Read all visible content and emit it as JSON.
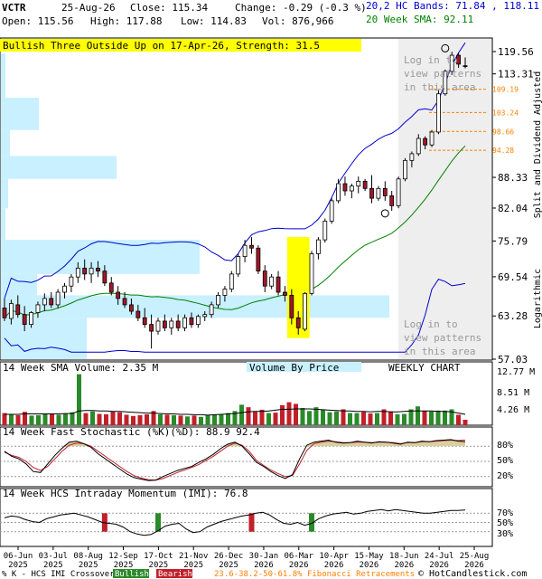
{
  "header": {
    "symbol": "VCTR",
    "date": "25-Aug-26",
    "close_label": "Close: 115.34",
    "change_label": "Change: -0.29 (-0.3 %)",
    "open_label": "Open: 115.56",
    "high_label": "High: 117.88",
    "low_label": "Low: 114.83",
    "vol_label": "Vol: 876,966",
    "hc_bands_label": "20,2 HC Bands: 71.84 , 118.11",
    "sma_label": "20 Week SMA: 92.11",
    "pattern_banner": "Bullish Three Outside Up on 17-Apr-26, Strength: 31.5"
  },
  "overlay_text": {
    "login_top": [
      "Log in to",
      "view patterns",
      "in this area"
    ],
    "login_bottom": [
      "Log in to",
      "view patterns",
      "in this area"
    ],
    "side_label": "Split and Dividend Adjusted",
    "log_label": "Logarithmic",
    "weekly_chart": "WEEKLY CHART",
    "volume_by_price": "Volume By Price"
  },
  "colors": {
    "bull": "#2a8a2a",
    "bear": "#c0202a",
    "band": "#0000cc",
    "sma": "#008000",
    "vbp": "#c8f0ff",
    "highlight": "#ffff00",
    "fib": "#ff7f00",
    "shade": "#eeeeee"
  },
  "chart_data": [
    {
      "type": "candlestick",
      "scale": "log",
      "ylim": [
        57.03,
        119.56
      ],
      "price_ticks": [
        119.56,
        113.31,
        88.33,
        82.04,
        75.79,
        69.54,
        63.28,
        57.03
      ],
      "fib_levels": [
        "109.19",
        "103.24",
        "98.66",
        "94.28"
      ],
      "candles": [
        {
          "o": 64.5,
          "h": 66.0,
          "l": 62.5,
          "c": 63.0
        },
        {
          "o": 62.9,
          "h": 65.8,
          "l": 62.0,
          "c": 65.2
        },
        {
          "o": 65.0,
          "h": 66.5,
          "l": 63.0,
          "c": 63.5
        },
        {
          "o": 63.5,
          "h": 64.8,
          "l": 61.0,
          "c": 62.0
        },
        {
          "o": 62.0,
          "h": 64.0,
          "l": 61.5,
          "c": 63.8
        },
        {
          "o": 63.8,
          "h": 65.5,
          "l": 63.0,
          "c": 65.0
        },
        {
          "o": 65.0,
          "h": 66.8,
          "l": 64.0,
          "c": 66.0
        },
        {
          "o": 66.0,
          "h": 67.0,
          "l": 64.5,
          "c": 65.0
        },
        {
          "o": 65.0,
          "h": 67.5,
          "l": 64.5,
          "c": 67.0
        },
        {
          "o": 67.0,
          "h": 68.5,
          "l": 66.0,
          "c": 68.0
        },
        {
          "o": 68.0,
          "h": 70.0,
          "l": 67.0,
          "c": 69.5
        },
        {
          "o": 69.5,
          "h": 72.0,
          "l": 68.5,
          "c": 71.0
        },
        {
          "o": 71.0,
          "h": 72.5,
          "l": 69.0,
          "c": 70.0
        },
        {
          "o": 70.0,
          "h": 72.0,
          "l": 68.5,
          "c": 71.0
        },
        {
          "o": 71.0,
          "h": 72.2,
          "l": 69.5,
          "c": 70.5
        },
        {
          "o": 70.5,
          "h": 71.5,
          "l": 68.0,
          "c": 68.5
        },
        {
          "o": 68.5,
          "h": 69.5,
          "l": 66.5,
          "c": 67.0
        },
        {
          "o": 67.0,
          "h": 68.0,
          "l": 65.0,
          "c": 66.0
        },
        {
          "o": 66.0,
          "h": 67.0,
          "l": 64.5,
          "c": 65.0
        },
        {
          "o": 65.0,
          "h": 66.0,
          "l": 63.5,
          "c": 64.0
        },
        {
          "o": 64.0,
          "h": 65.0,
          "l": 62.5,
          "c": 63.0
        },
        {
          "o": 63.0,
          "h": 64.5,
          "l": 61.5,
          "c": 62.0
        },
        {
          "o": 62.0,
          "h": 63.5,
          "l": 58.5,
          "c": 61.0
        },
        {
          "o": 61.0,
          "h": 63.0,
          "l": 60.5,
          "c": 62.5
        },
        {
          "o": 62.5,
          "h": 63.5,
          "l": 61.0,
          "c": 61.5
        },
        {
          "o": 61.5,
          "h": 63.0,
          "l": 60.5,
          "c": 62.5
        },
        {
          "o": 62.5,
          "h": 63.5,
          "l": 61.0,
          "c": 61.5
        },
        {
          "o": 61.5,
          "h": 63.5,
          "l": 61.0,
          "c": 63.0
        },
        {
          "o": 63.0,
          "h": 63.8,
          "l": 61.5,
          "c": 62.0
        },
        {
          "o": 62.0,
          "h": 63.5,
          "l": 61.5,
          "c": 63.2
        },
        {
          "o": 63.2,
          "h": 64.0,
          "l": 62.5,
          "c": 63.5
        },
        {
          "o": 63.5,
          "h": 65.5,
          "l": 63.0,
          "c": 65.0
        },
        {
          "o": 65.0,
          "h": 67.0,
          "l": 64.5,
          "c": 66.5
        },
        {
          "o": 66.5,
          "h": 68.0,
          "l": 65.5,
          "c": 67.5
        },
        {
          "o": 67.5,
          "h": 70.5,
          "l": 67.0,
          "c": 70.0
        },
        {
          "o": 70.0,
          "h": 73.5,
          "l": 69.5,
          "c": 73.0
        },
        {
          "o": 73.0,
          "h": 76.0,
          "l": 72.0,
          "c": 75.0
        },
        {
          "o": 75.0,
          "h": 76.5,
          "l": 73.5,
          "c": 74.5
        },
        {
          "o": 74.5,
          "h": 75.0,
          "l": 70.0,
          "c": 70.5
        },
        {
          "o": 70.5,
          "h": 71.5,
          "l": 67.0,
          "c": 68.0
        },
        {
          "o": 68.0,
          "h": 70.0,
          "l": 67.5,
          "c": 69.5
        },
        {
          "o": 69.5,
          "h": 70.5,
          "l": 66.5,
          "c": 67.0
        },
        {
          "o": 67.0,
          "h": 68.0,
          "l": 65.5,
          "c": 66.5
        },
        {
          "o": 66.5,
          "h": 67.5,
          "l": 62.0,
          "c": 63.0
        },
        {
          "o": 63.0,
          "h": 64.0,
          "l": 60.5,
          "c": 61.5
        },
        {
          "o": 61.3,
          "h": 67.0,
          "l": 61.0,
          "c": 66.8
        },
        {
          "o": 66.8,
          "h": 74.0,
          "l": 66.5,
          "c": 73.5
        },
        {
          "o": 73.5,
          "h": 76.5,
          "l": 72.5,
          "c": 76.0
        },
        {
          "o": 76.0,
          "h": 80.0,
          "l": 75.5,
          "c": 79.5
        },
        {
          "o": 79.5,
          "h": 84.0,
          "l": 79.0,
          "c": 83.5
        },
        {
          "o": 83.5,
          "h": 88.0,
          "l": 83.0,
          "c": 87.0
        },
        {
          "o": 87.0,
          "h": 88.5,
          "l": 84.5,
          "c": 85.5
        },
        {
          "o": 85.5,
          "h": 87.0,
          "l": 84.0,
          "c": 86.5
        },
        {
          "o": 86.5,
          "h": 88.5,
          "l": 85.0,
          "c": 87.5
        },
        {
          "o": 87.5,
          "h": 88.0,
          "l": 85.5,
          "c": 86.0
        },
        {
          "o": 86.0,
          "h": 88.8,
          "l": 83.0,
          "c": 84.0
        },
        {
          "o": 84.0,
          "h": 86.5,
          "l": 83.5,
          "c": 86.0
        },
        {
          "o": 86.0,
          "h": 87.5,
          "l": 83.5,
          "c": 84.5
        },
        {
          "o": 84.5,
          "h": 85.5,
          "l": 81.5,
          "c": 82.5
        },
        {
          "o": 82.5,
          "h": 88.5,
          "l": 82.0,
          "c": 88.0
        },
        {
          "o": 88.0,
          "h": 92.5,
          "l": 87.5,
          "c": 92.0
        },
        {
          "o": 92.0,
          "h": 94.0,
          "l": 90.5,
          "c": 93.5
        },
        {
          "o": 93.5,
          "h": 98.0,
          "l": 93.0,
          "c": 97.0
        },
        {
          "o": 97.0,
          "h": 97.5,
          "l": 94.5,
          "c": 95.5
        },
        {
          "o": 95.5,
          "h": 99.0,
          "l": 95.0,
          "c": 98.5
        },
        {
          "o": 98.5,
          "h": 109.0,
          "l": 98.0,
          "c": 108.0
        },
        {
          "o": 108.0,
          "h": 114.5,
          "l": 107.5,
          "c": 114.0
        },
        {
          "o": 114.0,
          "h": 119.5,
          "l": 113.0,
          "c": 118.5
        },
        {
          "o": 118.5,
          "h": 119.2,
          "l": 115.0,
          "c": 116.0
        },
        {
          "o": 115.56,
          "h": 117.88,
          "l": 114.83,
          "c": 115.34
        }
      ],
      "volume": {
        "label": "14 Week SMA Volume: 2.35 M",
        "ticks": [
          "12.77 M",
          "8.51 M",
          "4.26 M"
        ],
        "ymax": 12.77,
        "bars": [
          2.9,
          2.7,
          2.4,
          3.2,
          2.3,
          2.4,
          2.6,
          2.8,
          2.5,
          2.7,
          3.1,
          12.2,
          2.9,
          3.3,
          2.7,
          2.6,
          3.3,
          3.1,
          2.5,
          2.2,
          2.4,
          2.6,
          3.4,
          2.6,
          2.5,
          2.4,
          2.3,
          2.1,
          2.3,
          2.0,
          2.4,
          2.6,
          2.5,
          2.9,
          3.4,
          4.9,
          4.3,
          3.2,
          3.7,
          2.9,
          3.0,
          4.8,
          5.5,
          5.1,
          4.1,
          3.4,
          4.3,
          3.7,
          3.1,
          3.3,
          3.8,
          2.9,
          2.9,
          3.2,
          2.8,
          2.9,
          3.8,
          3.3,
          2.6,
          2.7,
          3.8,
          4.5,
          3.4,
          3.3,
          3.5,
          3.5,
          3.8,
          2.5,
          1.3
        ],
        "sma": [
          2.6,
          2.6,
          2.6,
          2.7,
          2.7,
          2.7,
          2.7,
          2.7,
          2.7,
          2.8,
          2.8,
          3.4,
          3.5,
          3.5,
          3.4,
          3.4,
          3.3,
          3.3,
          3.2,
          3.1,
          3.0,
          2.9,
          2.9,
          2.8,
          2.7,
          2.7,
          2.6,
          2.6,
          2.5,
          2.5,
          2.4,
          2.5,
          2.6,
          2.7,
          2.8,
          3.0,
          3.2,
          3.3,
          3.3,
          3.4,
          3.6,
          3.8,
          3.8,
          3.9,
          3.9,
          3.9,
          3.8,
          3.7,
          3.6,
          3.5,
          3.4,
          3.4,
          3.3,
          3.3,
          3.2,
          3.3,
          3.3,
          3.2,
          3.2,
          3.3,
          3.4,
          3.4,
          3.4,
          3.4,
          3.3,
          3.3,
          3.2,
          2.9,
          2.6
        ]
      },
      "stochastic": {
        "label": "14 Week Fast Stochastic (%K)(%D): 88.9 92.4",
        "ticks": [
          "80%",
          "50%",
          "20%"
        ],
        "k": [
          70,
          60,
          55,
          45,
          30,
          28,
          45,
          62,
          76,
          88,
          90,
          85,
          78,
          65,
          55,
          45,
          35,
          25,
          18,
          15,
          12,
          13,
          20,
          26,
          32,
          36,
          40,
          48,
          55,
          64,
          75,
          84,
          88,
          80,
          65,
          48,
          40,
          30,
          22,
          16,
          24,
          55,
          82,
          88,
          90,
          92,
          88,
          86,
          87,
          90,
          88,
          86,
          89,
          88,
          86,
          84,
          88,
          87,
          90,
          89,
          91,
          92,
          93,
          90,
          89
        ],
        "d": [
          68,
          62,
          58,
          50,
          38,
          32,
          40,
          55,
          70,
          82,
          86,
          85,
          80,
          70,
          60,
          50,
          40,
          30,
          22,
          17,
          14,
          13,
          16,
          22,
          28,
          33,
          38,
          44,
          52,
          60,
          70,
          80,
          86,
          82,
          70,
          52,
          42,
          33,
          26,
          20,
          22,
          45,
          72,
          85,
          88,
          90,
          89,
          87,
          87,
          88,
          88,
          87,
          88,
          88,
          87,
          85,
          87,
          87,
          89,
          89,
          90,
          91,
          92,
          91,
          92
        ],
        "k_color": "#000000",
        "d_color": "#c0202a"
      },
      "momentum": {
        "label": "14 Week HCS Intraday Momentum (IMI): 76.8",
        "ticks": [
          "70%",
          "50%",
          "30%"
        ],
        "line": [
          60,
          64,
          62,
          56,
          52,
          50,
          58,
          62,
          66,
          68,
          70,
          66,
          62,
          56,
          50,
          48,
          46,
          40,
          30,
          25,
          22,
          24,
          32,
          42,
          46,
          48,
          36,
          28,
          30,
          40,
          46,
          52,
          56,
          60,
          64,
          66,
          70,
          72,
          66,
          56,
          48,
          46,
          50,
          44,
          48,
          58,
          64,
          68,
          70,
          72,
          68,
          70,
          74,
          76,
          78,
          75,
          78,
          76,
          74,
          72,
          70,
          70,
          72,
          74,
          76,
          76,
          77
        ]
      },
      "signals": [
        {
          "week": 15,
          "type": "bearish"
        },
        {
          "week": 23,
          "type": "bullish"
        },
        {
          "week": 37,
          "type": "bearish"
        },
        {
          "week": 46,
          "type": "bullish"
        }
      ],
      "x_labels": [
        [
          "06-Jun",
          "2025"
        ],
        [
          "03-Jul",
          "2025"
        ],
        [
          "08-Aug",
          "2025"
        ],
        [
          "12-Sep",
          "2025"
        ],
        [
          "17-Oct",
          "2025"
        ],
        [
          "21-Nov",
          "2025"
        ],
        [
          "26-Dec",
          "2025"
        ],
        [
          "30-Jan",
          "2026"
        ],
        [
          "06-Mar",
          "2026"
        ],
        [
          "10-Apr",
          "2026"
        ],
        [
          "15-May",
          "2026"
        ],
        [
          "18-Jun",
          "2026"
        ],
        [
          "24-Jul",
          "2026"
        ],
        [
          "25-Aug",
          "2026"
        ]
      ],
      "footer": {
        "legend": "% K - HCS IMI Crossover:",
        "bullish": "Bullish",
        "bearish": "Bearish",
        "fib_text": "23.6-38.2-50-61.8% Fibonacci Retracements",
        "copyright": "© HotCandlestick.com"
      }
    }
  ]
}
